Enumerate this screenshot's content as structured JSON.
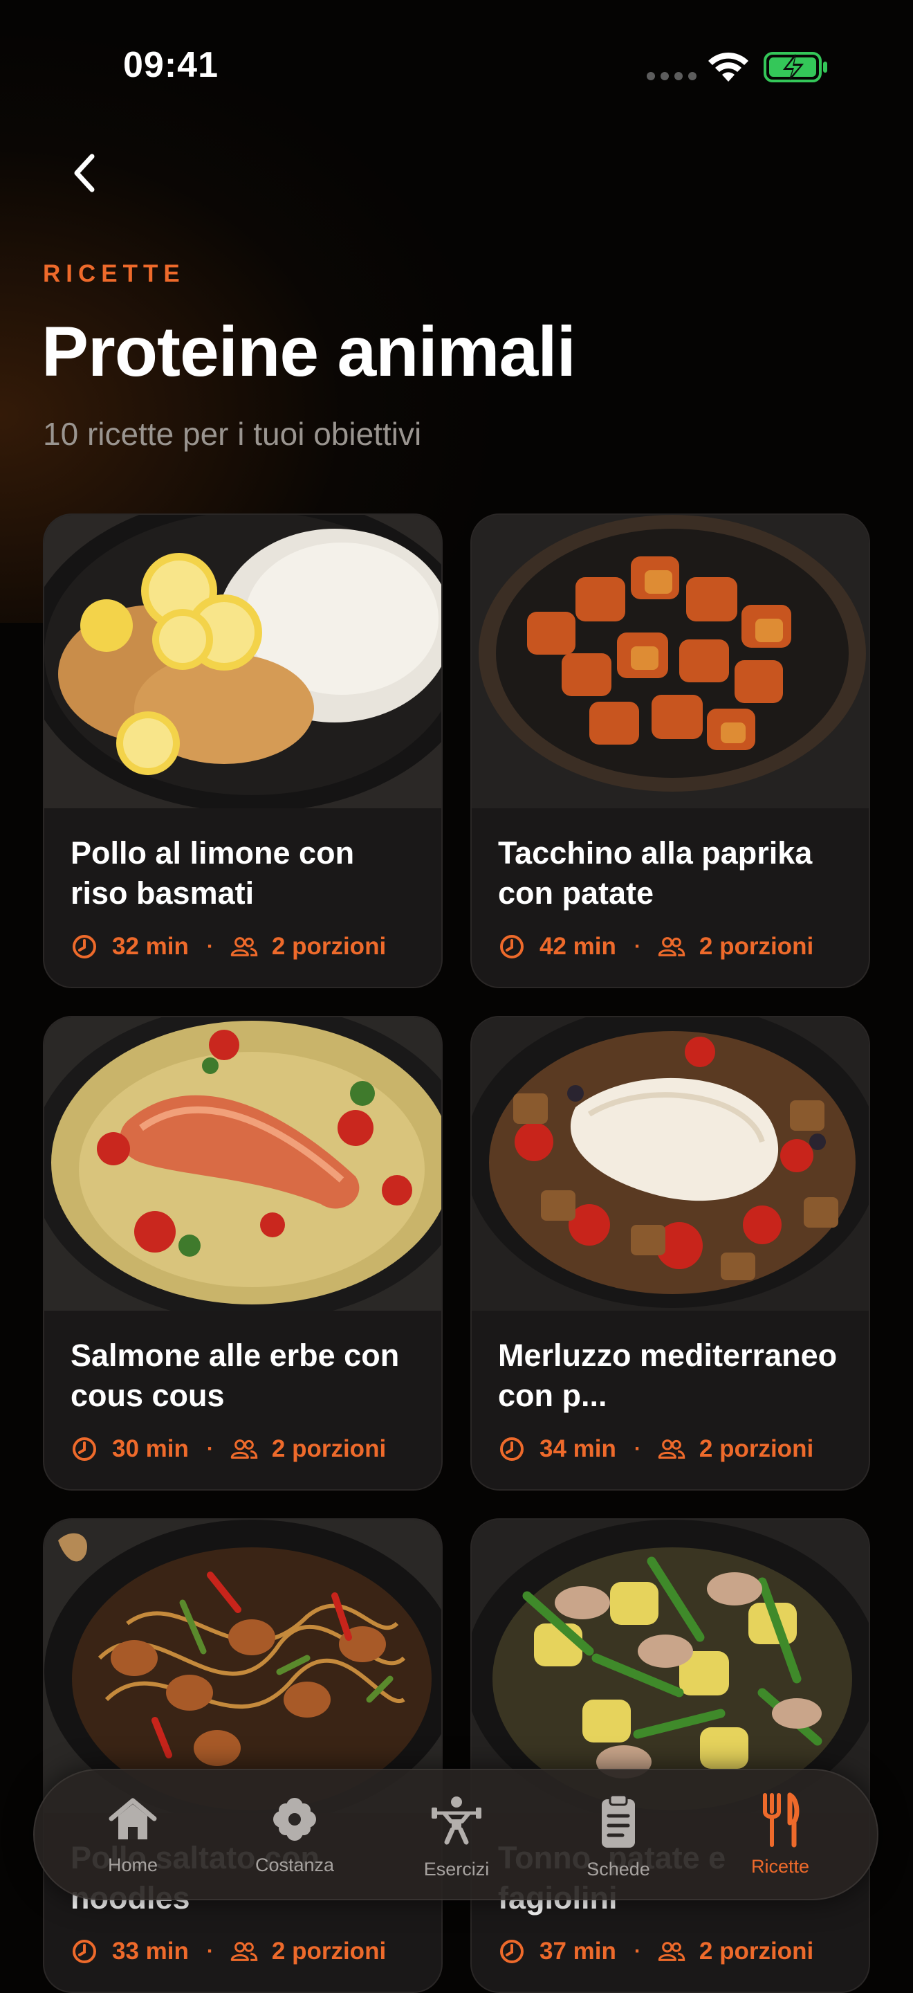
{
  "status_bar": {
    "time": "09:41"
  },
  "header": {
    "eyebrow": "RICETTE",
    "title": "Proteine animali",
    "subtitle": "10 ricette per i tuoi obiettivi"
  },
  "recipes": [
    {
      "title": "Pollo al limone con riso basmati",
      "time": "32 min",
      "servings": "2 porzioni"
    },
    {
      "title": "Tacchino alla paprika con patate",
      "time": "42 min",
      "servings": "2 porzioni"
    },
    {
      "title": "Salmone alle erbe con cous cous",
      "time": "30 min",
      "servings": "2 porzioni"
    },
    {
      "title": "Merluzzo mediterraneo con p...",
      "time": "34 min",
      "servings": "2 porzioni"
    },
    {
      "title": "Pollo saltato con noodles",
      "time": "33 min",
      "servings": "2 porzioni"
    },
    {
      "title": "Tonno, patate e fagiolini",
      "time": "37 min",
      "servings": "2 porzioni"
    }
  ],
  "tabbar": {
    "items": [
      {
        "label": "Home",
        "icon": "home-icon",
        "active": false
      },
      {
        "label": "Costanza",
        "icon": "flower-icon",
        "active": false
      },
      {
        "label": "Esercizi",
        "icon": "weightlifter-icon",
        "active": false
      },
      {
        "label": "Schede",
        "icon": "clipboard-icon",
        "active": false
      },
      {
        "label": "Ricette",
        "icon": "fork-knife-icon",
        "active": true
      }
    ]
  },
  "colors": {
    "accent": "#ee6a2b",
    "background": "#050403",
    "card": "#1a1818"
  }
}
